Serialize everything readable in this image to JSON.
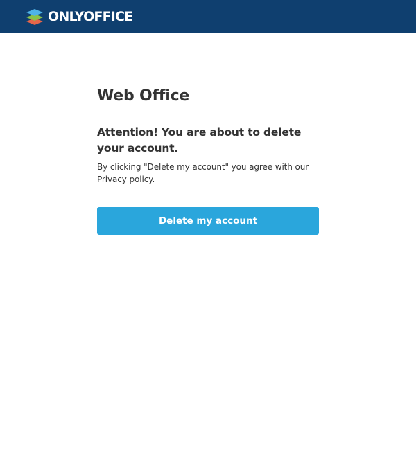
{
  "header": {
    "logo_text": "ONLYOFFICE",
    "logo_icon": "onlyoffice-layers-icon",
    "background_color": "#0f3f6f"
  },
  "main": {
    "title": "Web Office",
    "warning": "Attention! You are about to delete your account.",
    "consent_text": "By clicking \"Delete my account\" you agree with our Privacy policy.",
    "delete_button_label": "Delete my account",
    "button_color": "#2aa6dc"
  }
}
